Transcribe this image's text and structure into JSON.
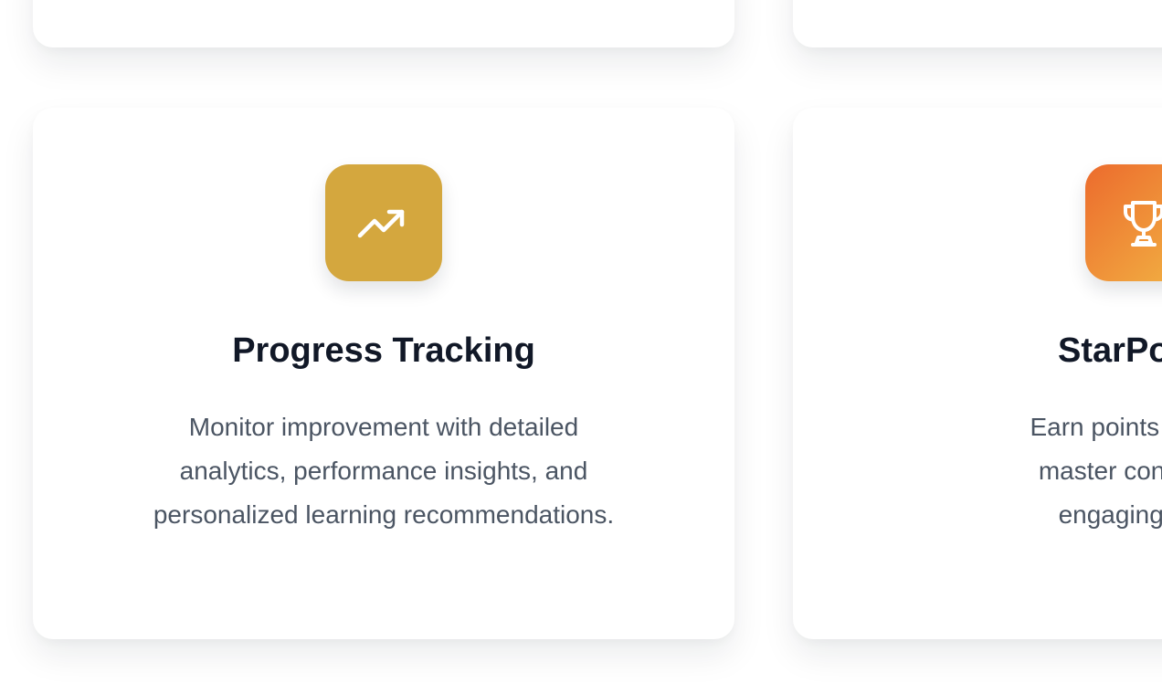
{
  "colors": {
    "progress_icon_bg": "#D4A73E",
    "starpower_icon_gradient_start": "#EC6B2D",
    "starpower_icon_gradient_end": "#F2B544",
    "title_color": "#111827",
    "body_color": "#4B5563"
  },
  "cards": [
    {
      "icon": "trending-up-icon",
      "title": "Progress Tracking",
      "description_lines": [
        "Monitor improvement with detailed",
        "analytics, performance insights, and",
        "personalized learning recommendations."
      ]
    },
    {
      "icon": "trophy-icon",
      "title": "StarPower",
      "description_lines": [
        "Earn points and ach",
        "master concepts, r",
        "engaging and r"
      ]
    }
  ]
}
